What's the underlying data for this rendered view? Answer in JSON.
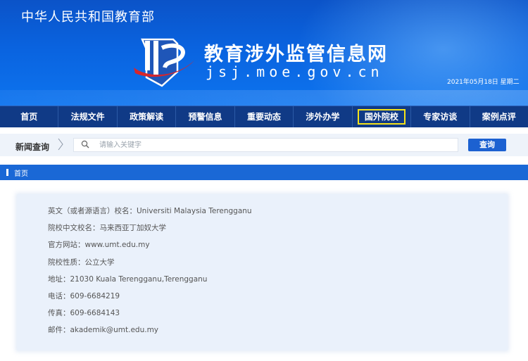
{
  "header": {
    "ministry": "中华人民共和国教育部",
    "site_title": "教育涉外监管信息网",
    "site_domain": "jsj.moe.gov.cn",
    "date": "2021年05月18日  星期二",
    "logo_icon": "moe-jsj-logo-icon"
  },
  "nav": {
    "items": [
      {
        "label": "首页"
      },
      {
        "label": "法规文件"
      },
      {
        "label": "政策解读"
      },
      {
        "label": "预警信息"
      },
      {
        "label": "重要动态"
      },
      {
        "label": "涉外办学"
      },
      {
        "label": "国外院校"
      },
      {
        "label": "专家访谈"
      },
      {
        "label": "案例点评"
      }
    ],
    "active_index": 6,
    "highlight_color": "#f4e21a"
  },
  "search": {
    "label": "新闻查询",
    "placeholder": "请输入关键字",
    "value": "",
    "button_label": "查询"
  },
  "breadcrumb": {
    "home": "首页"
  },
  "school": {
    "lines": [
      "英文（或者源语言）校名：Universiti Malaysia Terengganu",
      "院校中文校名：马来西亚丁加奴大学",
      "官方网站：www.umt.edu.my",
      "院校性质：公立大学",
      "地址：21030 Kuala Terengganu,Terengganu",
      "电话：609-6684219",
      "传真：609-6684143",
      "邮件：akademik@umt.edu.my"
    ]
  },
  "colors": {
    "banner_blue": "#0a63df",
    "nav_bg": "#103a86",
    "button_blue": "#1c61d1",
    "crumb_blue": "#1a68d6"
  }
}
